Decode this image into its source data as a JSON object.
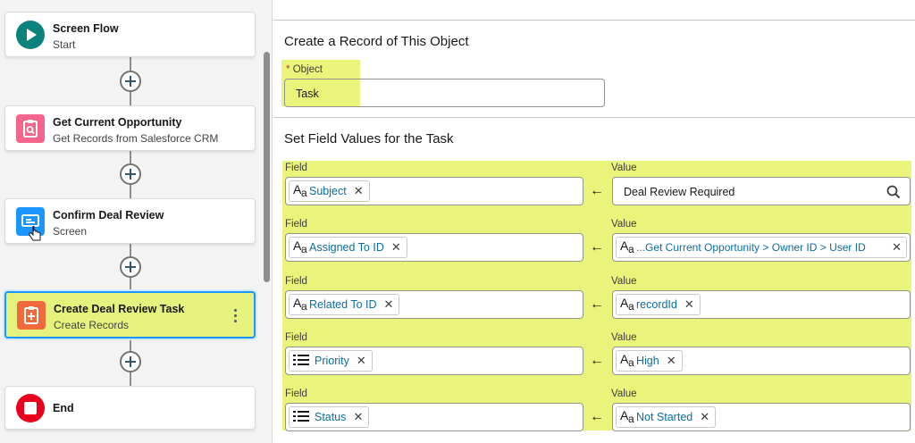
{
  "flow": {
    "nodes": [
      {
        "title": "Screen Flow",
        "subtitle": "Start",
        "icon": "play-icon",
        "color": "#0b827c"
      },
      {
        "title": "Get Current Opportunity",
        "subtitle": "Get Records from Salesforce CRM",
        "icon": "get-records-icon",
        "color": "#f4658c"
      },
      {
        "title": "Confirm Deal Review",
        "subtitle": "Screen",
        "icon": "screen-icon",
        "color": "#1b96ff"
      },
      {
        "title": "Create Deal Review Task",
        "subtitle": "Create Records",
        "icon": "create-records-icon",
        "color": "#f26a3b"
      },
      {
        "title": "End",
        "subtitle": "",
        "icon": "stop-icon",
        "color": "#ea001e"
      }
    ]
  },
  "panel": {
    "object_section_title": "Create a Record of This Object",
    "object_label": "Object",
    "object_required": "*",
    "object_value": "Task",
    "fields_section_title": "Set Field Values for the Task",
    "field_label": "Field",
    "value_label": "Value",
    "rows": [
      {
        "field": "Subject",
        "field_icon": "text-type-icon",
        "value": "Deal Review Required",
        "value_type": "search"
      },
      {
        "field": "Assigned To ID",
        "field_icon": "text-type-icon",
        "value": "...Get Current Opportunity > Owner ID > User ID",
        "value_type": "path"
      },
      {
        "field": "Related To ID",
        "field_icon": "text-type-icon",
        "value": "recordId",
        "value_type": "pill"
      },
      {
        "field": "Priority",
        "field_icon": "picklist-icon",
        "value": "High",
        "value_type": "pill"
      },
      {
        "field": "Status",
        "field_icon": "picklist-icon",
        "value": "Not Started",
        "value_type": "pill"
      }
    ],
    "highlight_color": "#eaf47a"
  }
}
